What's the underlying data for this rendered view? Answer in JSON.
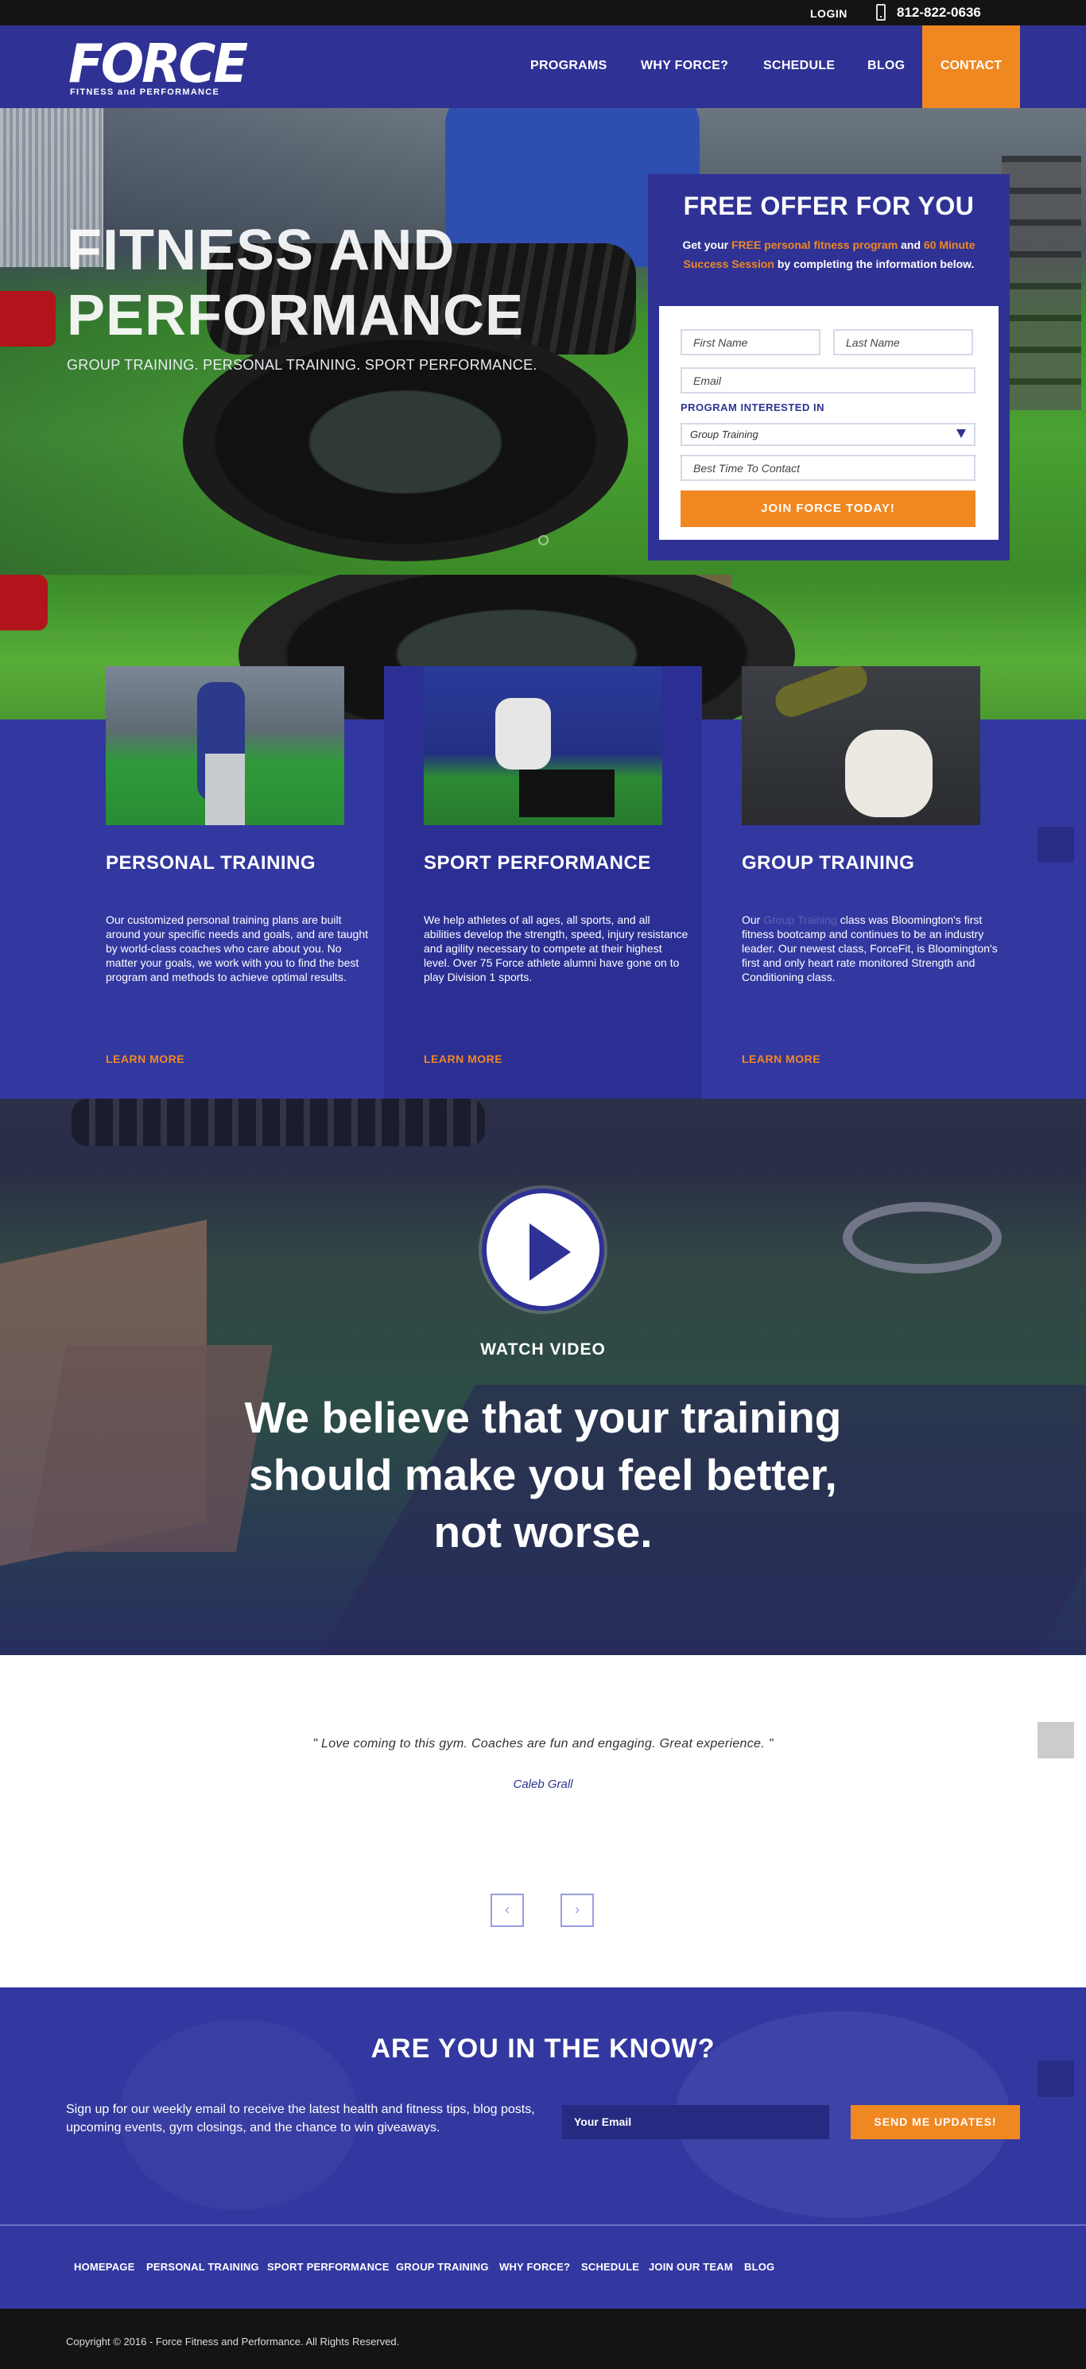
{
  "topbar": {
    "login": "LOGIN",
    "phone": "812-822-0636"
  },
  "brand": {
    "name": "FORCE",
    "tagline": "FITNESS and PERFORMANCE"
  },
  "nav": {
    "items": [
      "PROGRAMS",
      "WHY FORCE?",
      "SCHEDULE",
      "BLOG"
    ],
    "contact": "CONTACT"
  },
  "hero": {
    "title_line1": "FITNESS AND",
    "title_line2": "PERFORMANCE",
    "subtitle": "GROUP TRAINING. PERSONAL TRAINING. SPORT PERFORMANCE."
  },
  "offer": {
    "title": "FREE OFFER FOR YOU",
    "desc_part1": "Get your ",
    "desc_hl1": "FREE personal fitness program",
    "desc_part2": " and ",
    "desc_hl2": "60 Minute Success Session",
    "desc_part3": " by completing the information below.",
    "first_name": "First Name",
    "last_name": "Last Name",
    "email": "Email",
    "program_label": "PROGRAM INTERESTED IN",
    "program_selected": "Group Training",
    "best_time": "Best Time To Contact",
    "submit": "JOIN FORCE TODAY!"
  },
  "programs": [
    {
      "title": "PERSONAL TRAINING",
      "text": "Our customized personal training plans are built around your specific needs and goals, and are taught by world-class coaches who care about you. No matter your goals, we work with you to find the best program and methods to achieve optimal results.",
      "more": "LEARN MORE"
    },
    {
      "title": "SPORT PERFORMANCE",
      "text": "We help athletes of all ages, all sports, and all abilities develop the strength, speed, injury resistance and agility necessary to compete at their highest level. Over 75 Force athlete alumni have gone on to play Division 1 sports.",
      "more": "LEARN MORE"
    },
    {
      "title": "GROUP TRAINING",
      "text_pre": "Our ",
      "text_link": "Group Training",
      "text_post": " class was Bloomington's first fitness bootcamp and continues to be an industry leader. Our newest class, ForceFit, is Bloomington's first and only heart rate monitored Strength and Conditioning class.",
      "more": "LEARN MORE"
    }
  ],
  "video": {
    "watch": "WATCH VIDEO",
    "quote": "We believe that your training should make you feel better, not worse."
  },
  "testimonial": {
    "quote": "\" Love coming to this gym. Coaches are fun and engaging. Great experience. \"",
    "author": "Caleb Grall",
    "prev": "‹",
    "next": "›"
  },
  "newsletter": {
    "title": "ARE YOU IN THE KNOW?",
    "text": "Sign up for our weekly email to receive the latest health and fitness tips, blog posts, upcoming events, gym closings, and the chance to win giveaways.",
    "placeholder": "Your Email",
    "button": "SEND ME UPDATES!"
  },
  "footer": {
    "links": [
      "HOMEPAGE",
      "PERSONAL TRAINING",
      "SPORT PERFORMANCE",
      "GROUP TRAINING",
      "WHY FORCE?",
      "SCHEDULE",
      "JOIN OUR TEAM",
      "BLOG"
    ],
    "copyright": "Copyright © 2016 - Force Fitness and Performance. All Rights Reserved."
  },
  "colors": {
    "brand_blue": "#2f3294",
    "accent_orange": "#f08821",
    "dark": "#141414"
  },
  "icons": [
    "phone-icon",
    "play-icon",
    "chevron-down-icon",
    "chevron-left-icon",
    "chevron-right-icon"
  ]
}
